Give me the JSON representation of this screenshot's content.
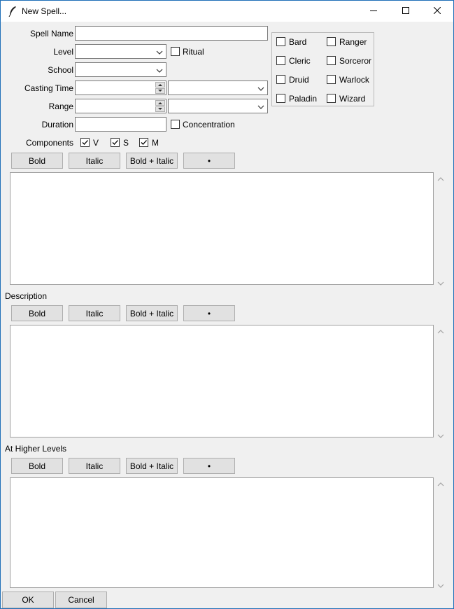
{
  "window": {
    "title": "New Spell...",
    "icons": {
      "app": "feather-icon",
      "minimize": "minimize-icon",
      "maximize": "maximize-icon",
      "close": "close-icon"
    }
  },
  "form": {
    "spell_name_label": "Spell Name",
    "spell_name_value": "",
    "level_label": "Level",
    "level_value": "",
    "ritual_label": "Ritual",
    "school_label": "School",
    "school_value": "",
    "casting_time_label": "Casting Time",
    "casting_time_value": "",
    "casting_time_unit": "",
    "range_label": "Range",
    "range_value": "",
    "range_unit": "",
    "duration_label": "Duration",
    "duration_value": "",
    "concentration_label": "Concentration",
    "components_label": "Components",
    "components": [
      {
        "label": "V",
        "checked": true
      },
      {
        "label": "S",
        "checked": true
      },
      {
        "label": "M",
        "checked": true
      }
    ]
  },
  "classes": [
    {
      "label": "Bard",
      "checked": false
    },
    {
      "label": "Ranger",
      "checked": false
    },
    {
      "label": "Cleric",
      "checked": false
    },
    {
      "label": "Sorceror",
      "checked": false
    },
    {
      "label": "Druid",
      "checked": false
    },
    {
      "label": "Warlock",
      "checked": false
    },
    {
      "label": "Paladin",
      "checked": false
    },
    {
      "label": "Wizard",
      "checked": false
    }
  ],
  "format_toolbar": {
    "bold": "Bold",
    "italic": "Italic",
    "bold_italic": "Bold + Italic",
    "bullet": "•"
  },
  "sections": {
    "description_label": "Description",
    "higher_levels_label": "At Higher Levels",
    "materials_text": "",
    "description_text": "",
    "higher_levels_text": ""
  },
  "footer": {
    "ok": "OK",
    "cancel": "Cancel"
  },
  "colors": {
    "window_border": "#1f6fb8",
    "background": "#f0f0f0",
    "button": "#e1e1e1"
  }
}
